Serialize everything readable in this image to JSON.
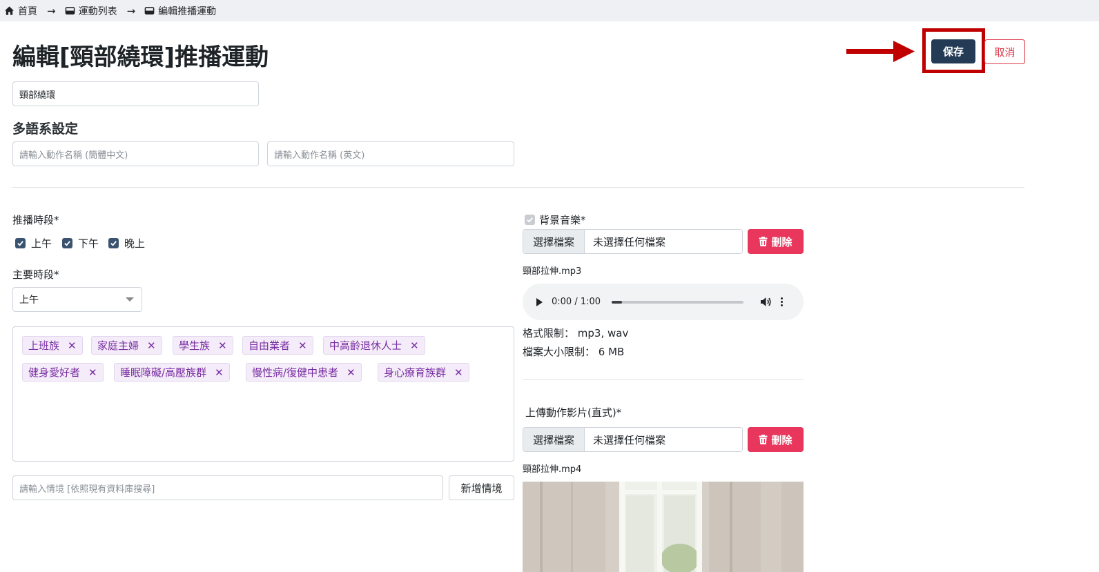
{
  "breadcrumb": {
    "items": [
      {
        "label": "首頁",
        "icon": "home-icon"
      },
      {
        "label": "運動列表",
        "icon": "inbox-icon"
      },
      {
        "label": "編輯推播運動",
        "icon": "inbox-icon"
      }
    ]
  },
  "page": {
    "title": "編輯[頸部繞環]推播運動"
  },
  "actions": {
    "save_label": "保存",
    "cancel_label": "取消",
    "highlight_color": "#c00000"
  },
  "name_input": {
    "value": "頸部繞環"
  },
  "multilang": {
    "heading": "多語系設定",
    "zh_cn_placeholder": "請輸入動作名稱 (簡體中文)",
    "en_placeholder": "請輸入動作名稱 (英文)"
  },
  "push_period": {
    "label": "推播時段*",
    "options": [
      {
        "label": "上午",
        "checked": true
      },
      {
        "label": "下午",
        "checked": true
      },
      {
        "label": "晚上",
        "checked": true
      }
    ]
  },
  "main_period": {
    "label": "主要時段*",
    "selected": "上午"
  },
  "scenarios": {
    "tags": [
      "上班族",
      "家庭主婦",
      "學生族",
      "自由業者",
      "中高齡退休人士",
      "健身愛好者",
      "睡眠障礙/高壓族群",
      "慢性病/復健中患者",
      "身心療育族群"
    ],
    "remove_glyph": "✕",
    "search_placeholder": "請輸入情境 [依照現有資料庫搜尋]",
    "add_label": "新增情境"
  },
  "bg_music": {
    "label": "背景音樂*",
    "checked": true,
    "choose_label": "選擇檔案",
    "no_file_text": "未選擇任何檔案",
    "delete_label": "刪除",
    "filename": "頸部拉伸.mp3",
    "player_time": "0:00 / 1:00",
    "progress": 0.08,
    "format_limit": "格式限制： mp3, wav",
    "size_limit": "檔案大小限制： 6 MB"
  },
  "video": {
    "label": "上傳動作影片(直式)*",
    "choose_label": "選擇檔案",
    "no_file_text": "未選擇任何檔案",
    "delete_label": "刪除",
    "filename": "頸部拉伸.mp4"
  },
  "colors": {
    "primary": "#243b55",
    "danger": "#e8365d",
    "tag_text": "#7a2ea3",
    "tag_bg": "#f4edf9"
  }
}
